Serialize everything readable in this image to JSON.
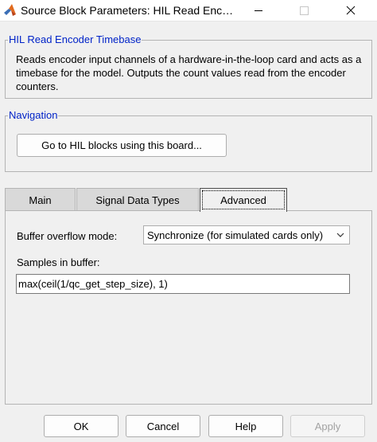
{
  "window": {
    "title": "Source Block Parameters: HIL Read Enc…",
    "icon": "matlab-icon"
  },
  "description_group": {
    "title": "HIL Read Encoder Timebase",
    "text": "Reads encoder input channels of a hardware-in-the-loop card  and acts as a timebase for the model. Outputs the count values read from the encoder counters."
  },
  "navigation_group": {
    "title": "Navigation",
    "button_label": "Go to HIL blocks using this board..."
  },
  "tabs": [
    {
      "label": "Main",
      "active": false
    },
    {
      "label": "Signal Data Types",
      "active": false
    },
    {
      "label": "Advanced",
      "active": true
    }
  ],
  "advanced": {
    "buffer_overflow_label": "Buffer overflow mode:",
    "buffer_overflow_value": "Synchronize (for simulated cards only)",
    "samples_label": "Samples in buffer:",
    "samples_value": "max(ceil(1/qc_get_step_size), 1)"
  },
  "footer": {
    "ok": "OK",
    "cancel": "Cancel",
    "help": "Help",
    "apply": "Apply"
  },
  "colors": {
    "group_title": "#0023c8",
    "background": "#f0f0f0",
    "disabled_text": "#a2a2a2"
  }
}
